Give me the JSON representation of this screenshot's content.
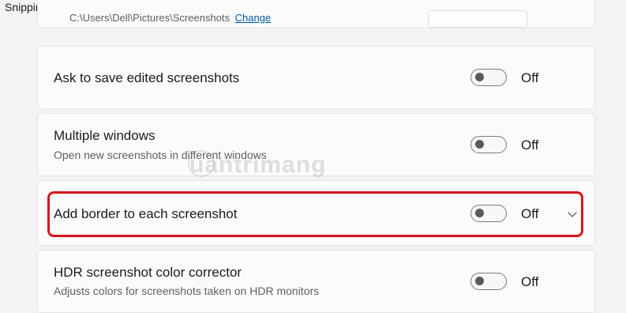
{
  "app": {
    "title": "Snipping Tool"
  },
  "screenshot_folder": {
    "path": "C:\\Users\\Dell\\Pictures\\Screenshots",
    "change_label": "Change"
  },
  "settings": [
    {
      "label": "Ask to save edited screenshots",
      "description": "",
      "state": "Off"
    },
    {
      "label": "Multiple windows",
      "description": "Open new screenshots in different windows",
      "state": "Off"
    },
    {
      "label": "Add border to each screenshot",
      "description": "",
      "state": "Off"
    },
    {
      "label": "HDR screenshot color corrector",
      "description": "Adjusts colors for screenshots taken on HDR monitors",
      "state": "Off"
    }
  ],
  "watermark": {
    "text": "uantrimang"
  },
  "colors": {
    "highlight": "#d7141e",
    "link": "#005a9e",
    "background": "#f3f3f3"
  }
}
